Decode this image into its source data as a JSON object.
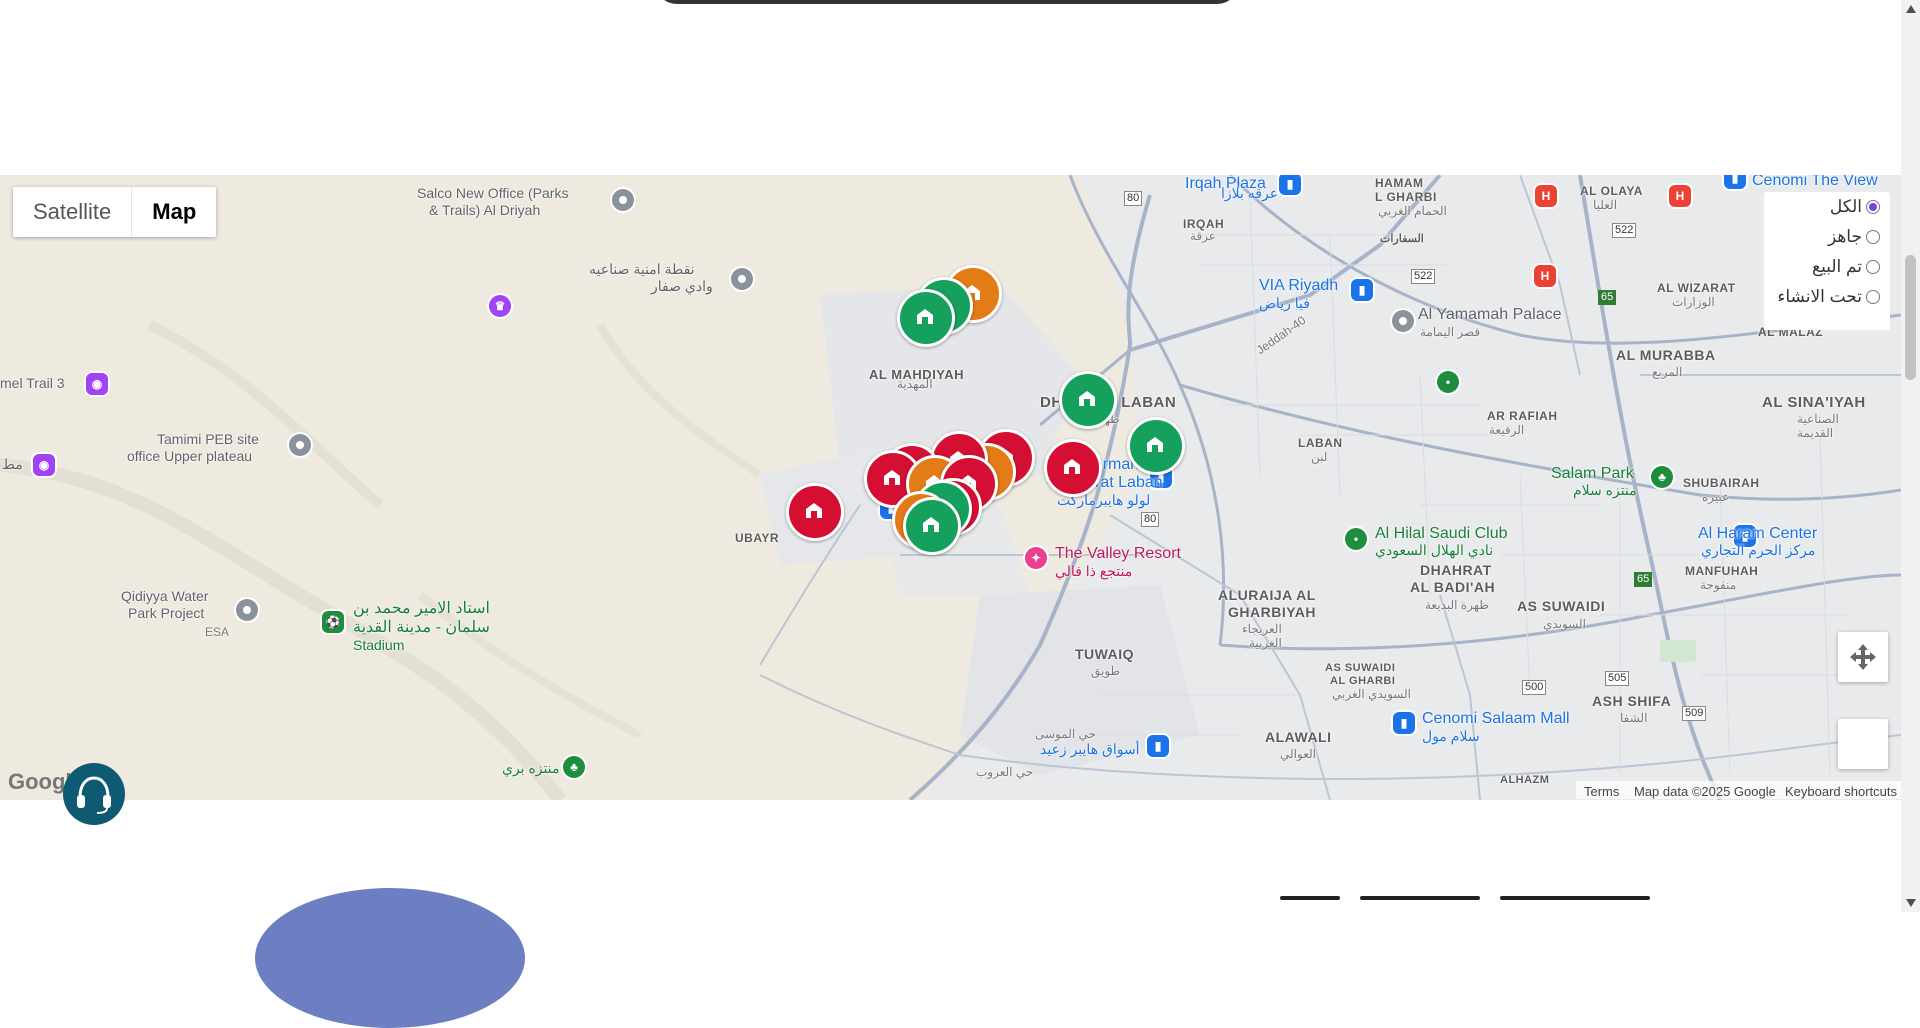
{
  "map_type": {
    "satellite": "Satellite",
    "map": "Map",
    "active": "Map"
  },
  "filter": {
    "options": [
      {
        "label": "الكل",
        "checked": true
      },
      {
        "label": "جاهز",
        "checked": false
      },
      {
        "label": "تم البيع",
        "checked": false
      },
      {
        "label": "تحت الانشاء",
        "checked": false
      }
    ]
  },
  "map_labels": {
    "salco": "Salco New Office (Parks",
    "salco2": "& Trails) Al Driyah",
    "checkpoint_ar1": "نقطة امنية صناعيه",
    "checkpoint_ar2": "وادي صفار",
    "camel_trail": "mel Trail 3",
    "tamimi1": "Tamimi PEB site",
    "tamimi2": "office Upper plateau",
    "mat_ar": "مط",
    "qidiyya1": "Qidiyya Water",
    "qidiyya2": "Park Project",
    "esa": "ESA",
    "stadium_ar1": "استاد الامير محمد بن",
    "stadium_ar2": "سلمان - مدينة القدية",
    "stadium_en": "Stadium",
    "park_ar": "منتزه بري",
    "al_mahdiyah": "AL MAHDIYAH",
    "al_mahdiyah_ar": "المهدية",
    "dhahrat_laban": "DHAHRAT LABAN",
    "dhahrat_laban_ar": "ظهرة لبن",
    "lulu": "u Hypermarket",
    "lulu2": "- Dhahrat Laban",
    "lulu_ar": "لولو هايبرماركت",
    "ubayr": "UBAYR",
    "valley1": "The Valley Resort",
    "valley_ar": "منتجع ذا فالي",
    "irqah_plaza": "Irqah Plaza",
    "irqah_plaza_ar": "عرقه بلازا",
    "irqah": "IRQAH",
    "irqah_ar": "عرقة",
    "hammam": "HAMAM",
    "hammam2": "L GHARBI",
    "hammam_ar": "الحمام الغربي",
    "olaya": "AL OLAYA",
    "olaya_ar": "العليا",
    "shifarat_ar": "السفارات",
    "via1": "VIA Riyadh",
    "via_ar": "فيا رياض",
    "jeddah40": "Jeddah-40",
    "yamamah": "Al Yamamah Palace",
    "yamamah_ar": "قصر اليمامة",
    "wizarat": "AL WIZARAT",
    "wizarat_ar": "الوزارات",
    "murabba": "AL MURABBA",
    "murabba_ar": "المربع",
    "malaz": "AL MALAZ",
    "ar_rafiah": "AR RAFIAH",
    "ar_rafiah_ar": "الرفيعة",
    "laban": "LABAN",
    "laban_ar": "لبن",
    "sinaiyah": "AL SINA'IYAH",
    "sinaiyah_ar1": "الصناعية",
    "sinaiyah_ar2": "القديمة",
    "salam_park": "Salam Park",
    "salam_park_ar": "منتزه سلام",
    "hilal": "Al Hilal Saudi Club",
    "hilal_ar": "نادي الهلال السعودي",
    "haram": "Al Haram Center",
    "haram_ar": "مركز الحرم التجاري",
    "shubairah": "SHUBAIRAH",
    "shubairah_ar": "عبيرة",
    "manfuhah": "MANFUHAH",
    "manfuhah_ar": "منفوحة",
    "badiah1": "DHAHRAT",
    "badiah2": "AL BADI'AH",
    "badiah_ar": "ظهرة البديعة",
    "suwaidi": "AS SUWAIDI",
    "suwaidi_ar": "السويدي",
    "uraija1": "ALURAIJA AL",
    "uraija2": "GHARBIYAH",
    "uraija_ar1": "العريجاء",
    "uraija_ar2": "الغربية",
    "tuwaiq": "TUWAIQ",
    "tuwaiq_ar": "طويق",
    "suwaidi_gh1": "AS SUWAIDI",
    "suwaidi_gh2": "AL GHARBI",
    "suwaidi_gh_ar": "السويدي الغربي",
    "cenomi": "Cenomi Salaam Mall",
    "cenomi_ar": "سلام مول",
    "shifa": "ASH SHIFA",
    "shifa_ar": "الشفا",
    "alawali": "ALAWALI",
    "alawali_ar": "العوالي",
    "hyper_ar": "أسواق هايبر زعيد",
    "musa_ar": "حي الموسى",
    "uroob_ar": "حي العروب",
    "alhazm": "ALHAZM",
    "cenomi_views": "Cenomi The View"
  },
  "shields": {
    "r80a": "80",
    "r80b": "80",
    "r522a": "522",
    "r522b": "522",
    "r65a": "65",
    "r65b": "65",
    "r500": "500",
    "r505": "505",
    "r509": "509"
  },
  "attribution": {
    "terms": "Terms",
    "map_data": "Map data ©2025 Google",
    "shortcuts": "Keyboard shortcuts",
    "google": "Google"
  },
  "markers": [
    {
      "status": "sold",
      "color": "#d50f33"
    },
    {
      "status": "ready",
      "color": "#16a05d"
    },
    {
      "status": "under_construction",
      "color": "#e37b16"
    }
  ]
}
